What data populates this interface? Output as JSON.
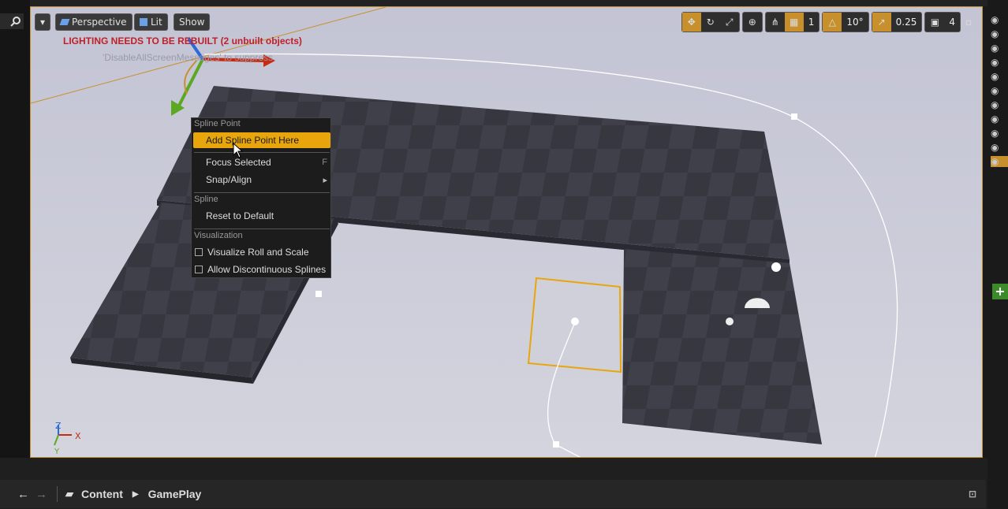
{
  "viewport": {
    "menu_button": "▾",
    "perspective_label": "Perspective",
    "lit_label": "Lit",
    "show_label": "Show",
    "warning_text": "LIGHTING NEEDS TO BE REBUILT (2 unbuilt objects)",
    "warning_hint": "'DisableAllScreenMessages' to suppress",
    "axis_x": "X",
    "axis_y": "Y",
    "axis_z": "Z"
  },
  "toolbar_right": {
    "grid_count": "1",
    "rotation_snap": "10°",
    "scale_snap": "0.25",
    "camera_speed": "4"
  },
  "context_menu": {
    "section_spline_point": "Spline Point",
    "add_spline_point": "Add Spline Point Here",
    "focus_selected": "Focus Selected",
    "focus_shortcut": "F",
    "snap_align": "Snap/Align",
    "section_spline": "Spline",
    "reset_default": "Reset to Default",
    "section_visualization": "Visualization",
    "visualize_roll": "Visualize Roll and Scale",
    "allow_discontinuous": "Allow Discontinuous Splines"
  },
  "content_browser": {
    "crumb_root": "Content",
    "crumb_current": "GamePlay"
  },
  "colors": {
    "accent": "#c8902c",
    "highlight": "#e8a60c",
    "warning": "#c0202a"
  }
}
